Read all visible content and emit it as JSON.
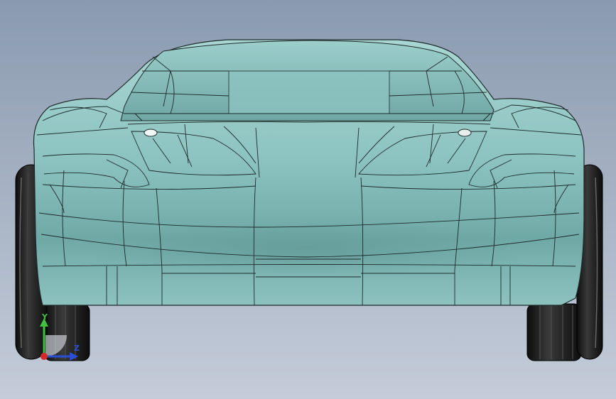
{
  "viewport": {
    "background_top": "#8a9aaf",
    "background_bottom": "#c4ccd9"
  },
  "model": {
    "body_color": "#8fc5c2",
    "edge_color": "#1e2a2a",
    "tire_color": "#1a1a1a"
  },
  "triad": {
    "y_label": "Y",
    "z_label": "Z",
    "y_color": "#3cc23c",
    "z_color": "#2a4fd6",
    "x_color": "#d62a2a"
  }
}
